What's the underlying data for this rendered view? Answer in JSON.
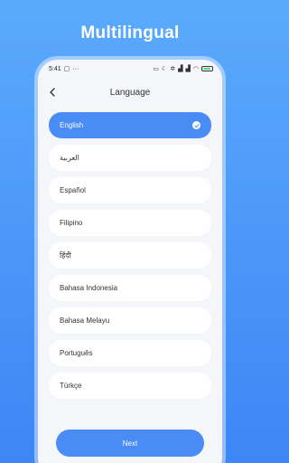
{
  "headline": "Multilingual",
  "status_bar": {
    "time": "5:41",
    "left_icons": [
      "sim-icon",
      "more-dots-icon"
    ],
    "right_icons": [
      "hd-icon",
      "moon-icon",
      "settings-icon",
      "signal-icon",
      "signal-icon",
      "wifi-icon",
      "battery-icon"
    ],
    "battery_level": 0.7
  },
  "nav": {
    "title": "Language",
    "back_icon": "chevron-left-icon"
  },
  "languages": [
    {
      "label": "English",
      "selected": true
    },
    {
      "label": "العربية",
      "selected": false
    },
    {
      "label": "Español",
      "selected": false
    },
    {
      "label": "Filipino",
      "selected": false
    },
    {
      "label": "हिंदी",
      "selected": false
    },
    {
      "label": "Bahasa Indonesia",
      "selected": false
    },
    {
      "label": "Bahasa Melayu",
      "selected": false
    },
    {
      "label": "Português",
      "selected": false
    },
    {
      "label": "Türkçe",
      "selected": false
    }
  ],
  "next_button": {
    "label": "Next"
  },
  "colors": {
    "background_top": "#5aaafc",
    "background_bottom": "#3d86f5",
    "accent": "#4a8cf5",
    "item_background": "#ffffff",
    "screen_background": "#f4f6fa"
  }
}
